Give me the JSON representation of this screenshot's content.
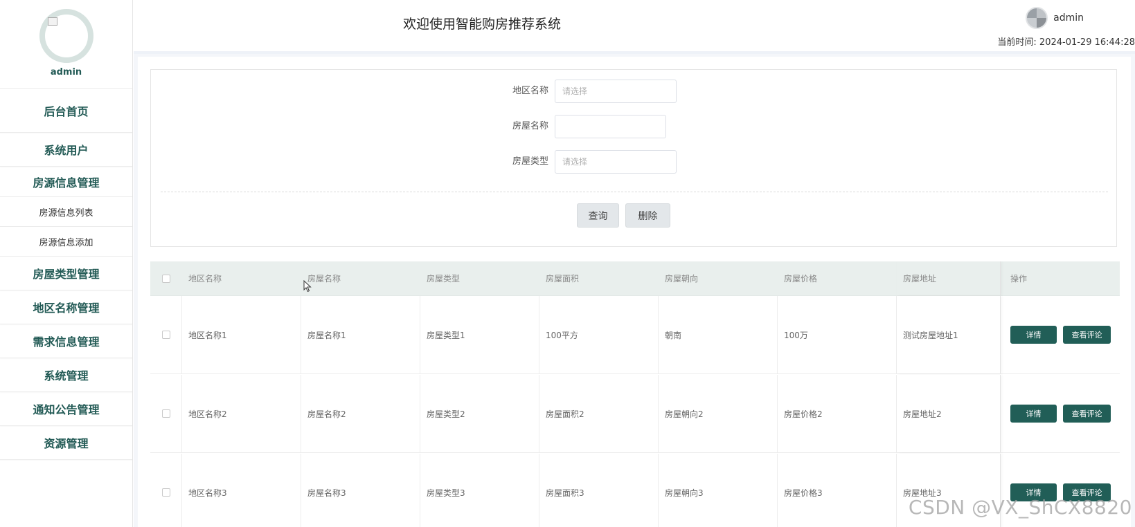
{
  "sidebar": {
    "user_name": "admin",
    "menu": [
      {
        "label": "后台首页"
      },
      {
        "label": "系统用户"
      },
      {
        "label": "房源信息管理"
      },
      {
        "label": "房屋类型管理"
      },
      {
        "label": "地区名称管理"
      },
      {
        "label": "需求信息管理"
      },
      {
        "label": "系统管理"
      },
      {
        "label": "通知公告管理"
      },
      {
        "label": "资源管理"
      }
    ],
    "submenu": [
      {
        "label": "房源信息列表"
      },
      {
        "label": "房源信息添加"
      }
    ]
  },
  "header": {
    "title": "欢迎使用智能购房推荐系统",
    "username": "admin",
    "time_label": "当前时间:",
    "time_value": "2024-01-29 16:44:28"
  },
  "search": {
    "region_label": "地区名称",
    "region_placeholder": "请选择",
    "name_label": "房屋名称",
    "name_value": "",
    "type_label": "房屋类型",
    "type_placeholder": "请选择",
    "query_button": "查询",
    "delete_button": "删除"
  },
  "table": {
    "columns": [
      "地区名称",
      "房屋名称",
      "房屋类型",
      "房屋面积",
      "房屋朝向",
      "房屋价格",
      "房屋地址",
      "操作"
    ],
    "rows": [
      [
        "地区名称1",
        "房屋名称1",
        "房屋类型1",
        "100平方",
        "朝南",
        "100万",
        "测试房屋地址1"
      ],
      [
        "地区名称2",
        "房屋名称2",
        "房屋类型2",
        "房屋面积2",
        "房屋朝向2",
        "房屋价格2",
        "房屋地址2"
      ],
      [
        "地区名称3",
        "房屋名称3",
        "房屋类型3",
        "房屋面积3",
        "房屋朝向3",
        "房屋价格3",
        "房屋地址3"
      ]
    ],
    "detail_button": "详情",
    "review_button": "查看评论"
  },
  "watermark": "CSDN @VX_ShCX8820"
}
